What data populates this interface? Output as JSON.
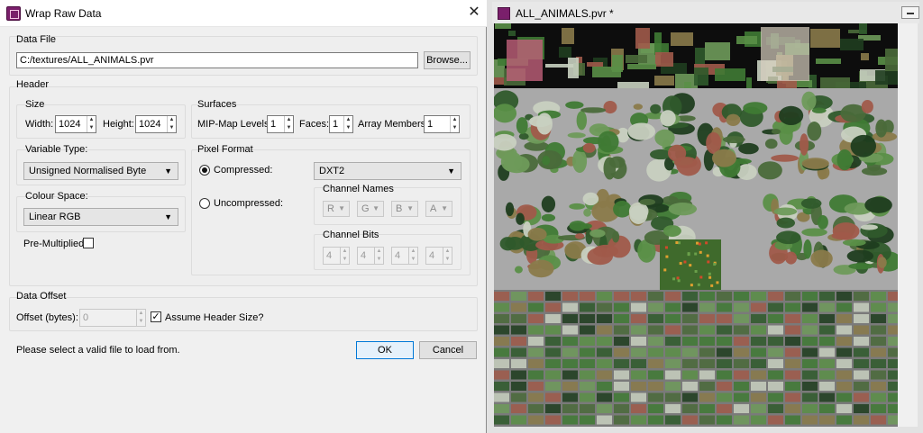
{
  "dialog": {
    "title": "Wrap Raw Data",
    "data_file": {
      "group_label": "Data File",
      "path": "C:/textures/ALL_ANIMALS.pvr",
      "browse_label": "Browse..."
    },
    "header": {
      "group_label": "Header",
      "size": {
        "label": "Size",
        "width_label": "Width:",
        "width_value": "1024",
        "height_label": "Height:",
        "height_value": "1024"
      },
      "surfaces": {
        "label": "Surfaces",
        "mip_label": "MIP-Map Levels:",
        "mip_value": "1",
        "faces_label": "Faces:",
        "faces_value": "1",
        "array_label": "Array Members:",
        "array_value": "1"
      },
      "variable_type": {
        "label": "Variable Type:",
        "value": "Unsigned Normalised Byte"
      },
      "colour_space": {
        "label": "Colour Space:",
        "value": "Linear RGB"
      },
      "premultiplied_label": "Pre-Multiplied:",
      "premultiplied_checked": false,
      "pixel_format": {
        "label": "Pixel Format",
        "compressed_label": "Compressed:",
        "compressed_selected": true,
        "compressed_value": "DXT2",
        "uncompressed_label": "Uncompressed:",
        "channel_names_label": "Channel Names",
        "channel_names": [
          "R",
          "G",
          "B",
          "A"
        ],
        "channel_bits_label": "Channel Bits",
        "channel_bits": [
          "4",
          "4",
          "4",
          "4"
        ]
      }
    },
    "data_offset": {
      "group_label": "Data Offset",
      "offset_label": "Offset (bytes):",
      "offset_value": "0",
      "assume_header_label": "Assume Header Size?",
      "assume_header_checked": true
    },
    "status_message": "Please select a valid file to load from.",
    "ok_label": "OK",
    "cancel_label": "Cancel",
    "close_icon": "close-icon"
  },
  "viewer": {
    "title": "ALL_ANIMALS.pvr *",
    "restore_icon": "restore-icon"
  }
}
